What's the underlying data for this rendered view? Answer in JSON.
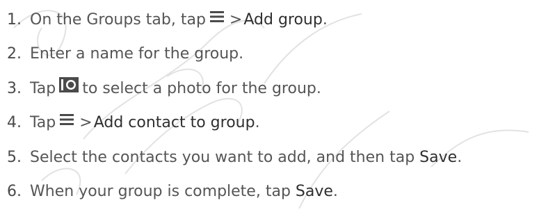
{
  "steps": [
    {
      "num": "1.",
      "before": "On the Groups tab, tap",
      "icon": "menu-icon",
      "sep": ">",
      "strong": "Add group",
      "after": "."
    },
    {
      "num": "2.",
      "text": "Enter a name for the group."
    },
    {
      "num": "3.",
      "before": "Tap",
      "icon": "camera-icon",
      "after": "to select a photo for the group."
    },
    {
      "num": "4.",
      "before": "Tap",
      "icon": "menu-icon",
      "sep": ">",
      "strong": "Add contact to group",
      "after": "."
    },
    {
      "num": "5.",
      "before": "Select the contacts you want to add, and then tap",
      "strong": "Save",
      "after": "."
    },
    {
      "num": "6.",
      "before": "When your group is complete, tap",
      "strong": "Save",
      "after": "."
    }
  ],
  "colors": {
    "text": "#555555",
    "strong": "#2f2f2f",
    "icon": "#4a4a4a"
  }
}
